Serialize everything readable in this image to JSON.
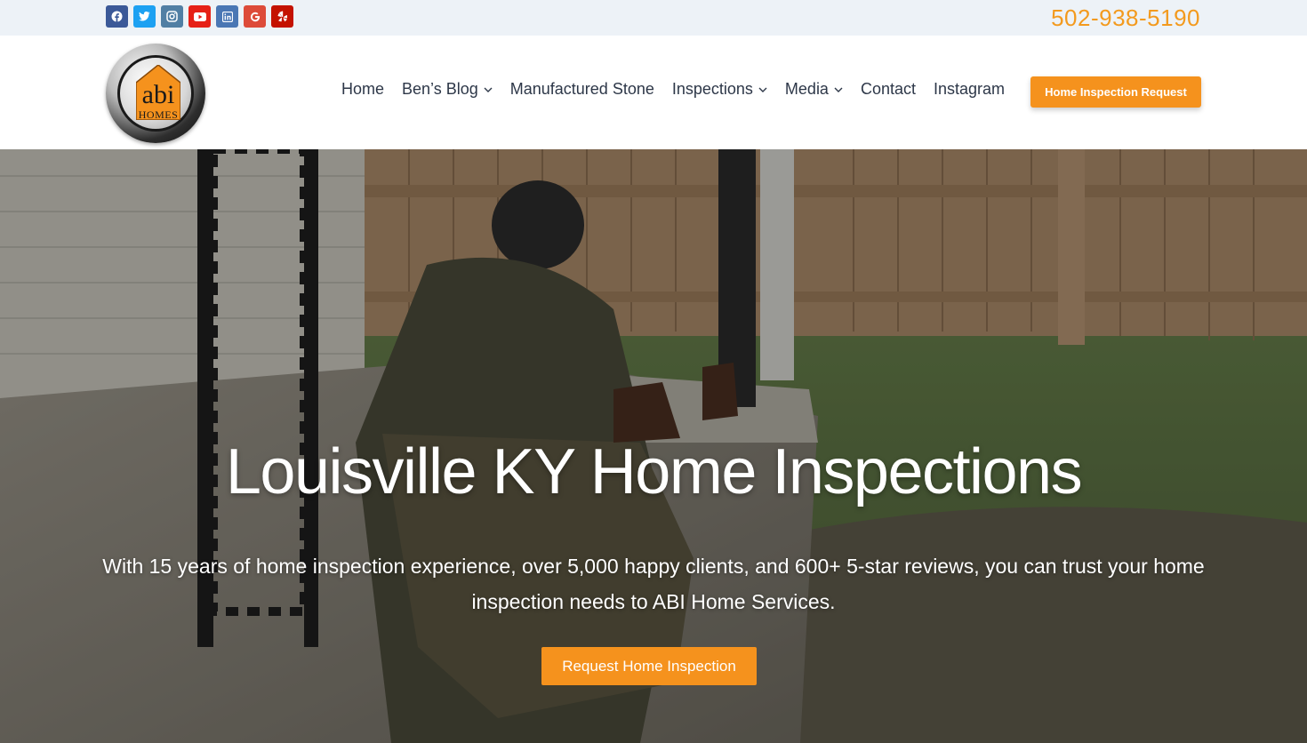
{
  "topbar": {
    "phone": "502-938-5190",
    "social": [
      {
        "icon": "facebook-icon",
        "color": "#3b5998"
      },
      {
        "icon": "twitter-icon",
        "color": "#1da1f2"
      },
      {
        "icon": "instagram-icon",
        "color": "#517fa4"
      },
      {
        "icon": "youtube-icon",
        "color": "#e62117"
      },
      {
        "icon": "linkedin-icon",
        "color": "#4a77b4"
      },
      {
        "icon": "google-icon",
        "color": "#dd4b39"
      },
      {
        "icon": "yelp-icon",
        "color": "#c41200"
      }
    ]
  },
  "header": {
    "logo": {
      "line1": "abi",
      "line2": "HOMES"
    },
    "nav": {
      "home": "Home",
      "blog": "Ben’s Blog",
      "stone": "Manufactured Stone",
      "inspections": "Inspections",
      "media": "Media",
      "contact": "Contact",
      "instagram": "Instagram"
    },
    "cta": "Home Inspection Request"
  },
  "hero": {
    "title": "Louisville KY Home Inspections",
    "subtitle": "With 15 years of home inspection experience, over 5,000 happy clients, and 600+ 5-star reviews, you can trust your home inspection needs to ABI Home Services.",
    "cta": "Request Home Inspection"
  },
  "colors": {
    "accent": "#f5921d",
    "phone": "#f39a1e",
    "topbar_bg": "#edf2f7",
    "nav_text": "#2d3748"
  }
}
